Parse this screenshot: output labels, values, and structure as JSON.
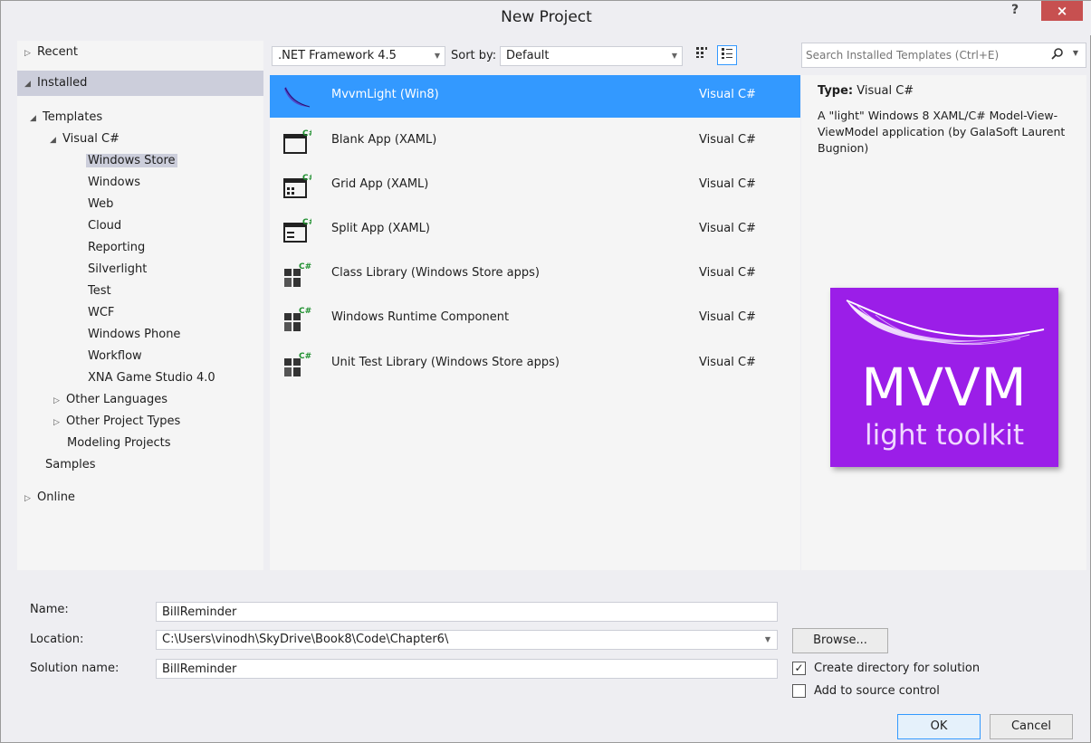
{
  "window": {
    "title": "New Project",
    "help_label": "?",
    "close_label": "×"
  },
  "nav": {
    "recent": "Recent",
    "installed": "Installed",
    "templates": "Templates",
    "visual_cs": "Visual C#",
    "items": [
      "Windows Store",
      "Windows",
      "Web",
      "Cloud",
      "Reporting",
      "Silverlight",
      "Test",
      "WCF",
      "Windows Phone",
      "Workflow",
      "XNA Game Studio 4.0"
    ],
    "other_languages": "Other Languages",
    "other_project_types": "Other Project Types",
    "modeling_projects": "Modeling Projects",
    "samples": "Samples",
    "online": "Online"
  },
  "toolbar": {
    "framework": ".NET Framework 4.5",
    "sort_label": "Sort by:",
    "sort_value": "Default"
  },
  "templates": [
    {
      "name": "MvvmLight (Win8)",
      "lang": "Visual C#",
      "icon": "feather-icon"
    },
    {
      "name": "Blank App (XAML)",
      "lang": "Visual C#",
      "icon": "blank-app-icon"
    },
    {
      "name": "Grid App (XAML)",
      "lang": "Visual C#",
      "icon": "grid-app-icon"
    },
    {
      "name": "Split App (XAML)",
      "lang": "Visual C#",
      "icon": "split-app-icon"
    },
    {
      "name": "Class Library (Windows Store apps)",
      "lang": "Visual C#",
      "icon": "class-library-icon"
    },
    {
      "name": "Windows Runtime Component",
      "lang": "Visual C#",
      "icon": "runtime-component-icon"
    },
    {
      "name": "Unit Test Library (Windows Store apps)",
      "lang": "Visual C#",
      "icon": "unit-test-icon"
    }
  ],
  "search": {
    "placeholder": "Search Installed Templates (Ctrl+E)"
  },
  "details": {
    "type_label": "Type:",
    "type_value": "Visual C#",
    "description": "A \"light\" Windows 8 XAML/C# Model-View-ViewModel application (by GalaSoft Laurent Bugnion)",
    "logo_main": "MVVM",
    "logo_sub": "light toolkit",
    "logo_color": "#9b1ee8"
  },
  "form": {
    "name_label": "Name:",
    "name_value": "BillReminder",
    "location_label": "Location:",
    "location_value": "C:\\Users\\vinodh\\SkyDrive\\Book8\\Code\\Chapter6\\",
    "solution_label": "Solution name:",
    "solution_value": "BillReminder",
    "browse_label": "Browse...",
    "create_dir_label": "Create directory for solution",
    "source_control_label": "Add to source control",
    "ok_label": "OK",
    "cancel_label": "Cancel"
  },
  "colors": {
    "selection": "#3399ff",
    "nav_selected": "#cccedb"
  }
}
